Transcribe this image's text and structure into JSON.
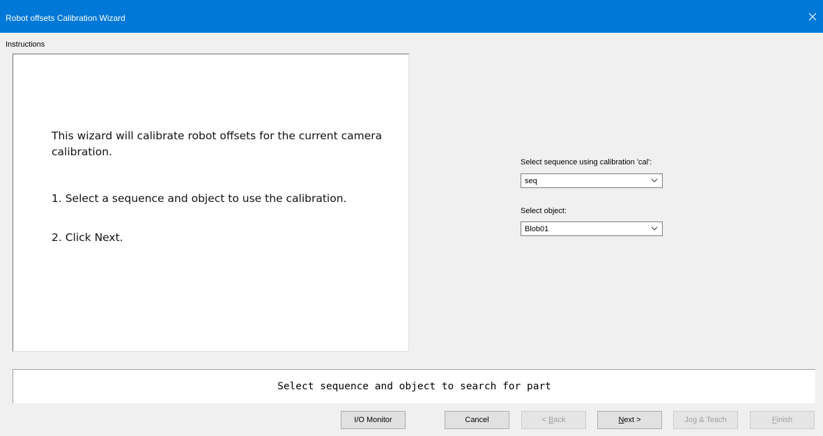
{
  "window": {
    "title": "Robot offsets Calibration Wizard"
  },
  "instructions": {
    "label": "Instructions",
    "paragraph1": "This wizard will calibrate robot offsets for the current camera calibration.",
    "step1": "1. Select a sequence and object to use the calibration.",
    "step2": "2. Click Next."
  },
  "selectors": {
    "sequence_label": "Select sequence using calibration 'cal':",
    "sequence_value": "seq",
    "object_label": "Select object:",
    "object_value": "Blob01"
  },
  "status": {
    "message": "Select sequence and object to search for part"
  },
  "buttons": {
    "io_monitor": "I/O Monitor",
    "cancel": "Cancel",
    "back_prefix": "< ",
    "back_mnemonic": "B",
    "back_rest": "ack",
    "next_mnemonic": "N",
    "next_rest": "ext >",
    "jog_teach": "Jog & Teach",
    "finish_mnemonic": "F",
    "finish_rest": "inish"
  },
  "colors": {
    "titlebar": "#0078d7",
    "disabled_text": "#a0a0a0"
  }
}
